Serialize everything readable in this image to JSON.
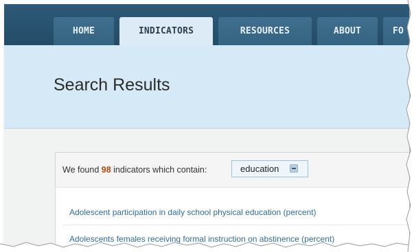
{
  "nav": {
    "tabs": [
      {
        "label": "HOME"
      },
      {
        "label": "INDICATORS"
      },
      {
        "label": "RESOURCES"
      },
      {
        "label": "ABOUT"
      },
      {
        "label": "FO"
      }
    ],
    "active_tab": "INDICATORS"
  },
  "banner": {
    "title": "Search Results"
  },
  "results": {
    "summary_prefix": "We found ",
    "count": "98",
    "summary_suffix": " indicators which contain:",
    "search_term": "education",
    "items": [
      {
        "label": "Adolescent participation in daily school physical education (percent)"
      },
      {
        "label": "Adolescents females receiving formal instruction on abstinence (percent)"
      }
    ]
  },
  "colors": {
    "nav_bg": "#2d5a78",
    "banner_bg": "#d6e9f6",
    "count_color": "#b5470f",
    "link_color": "#2f6e9f"
  }
}
